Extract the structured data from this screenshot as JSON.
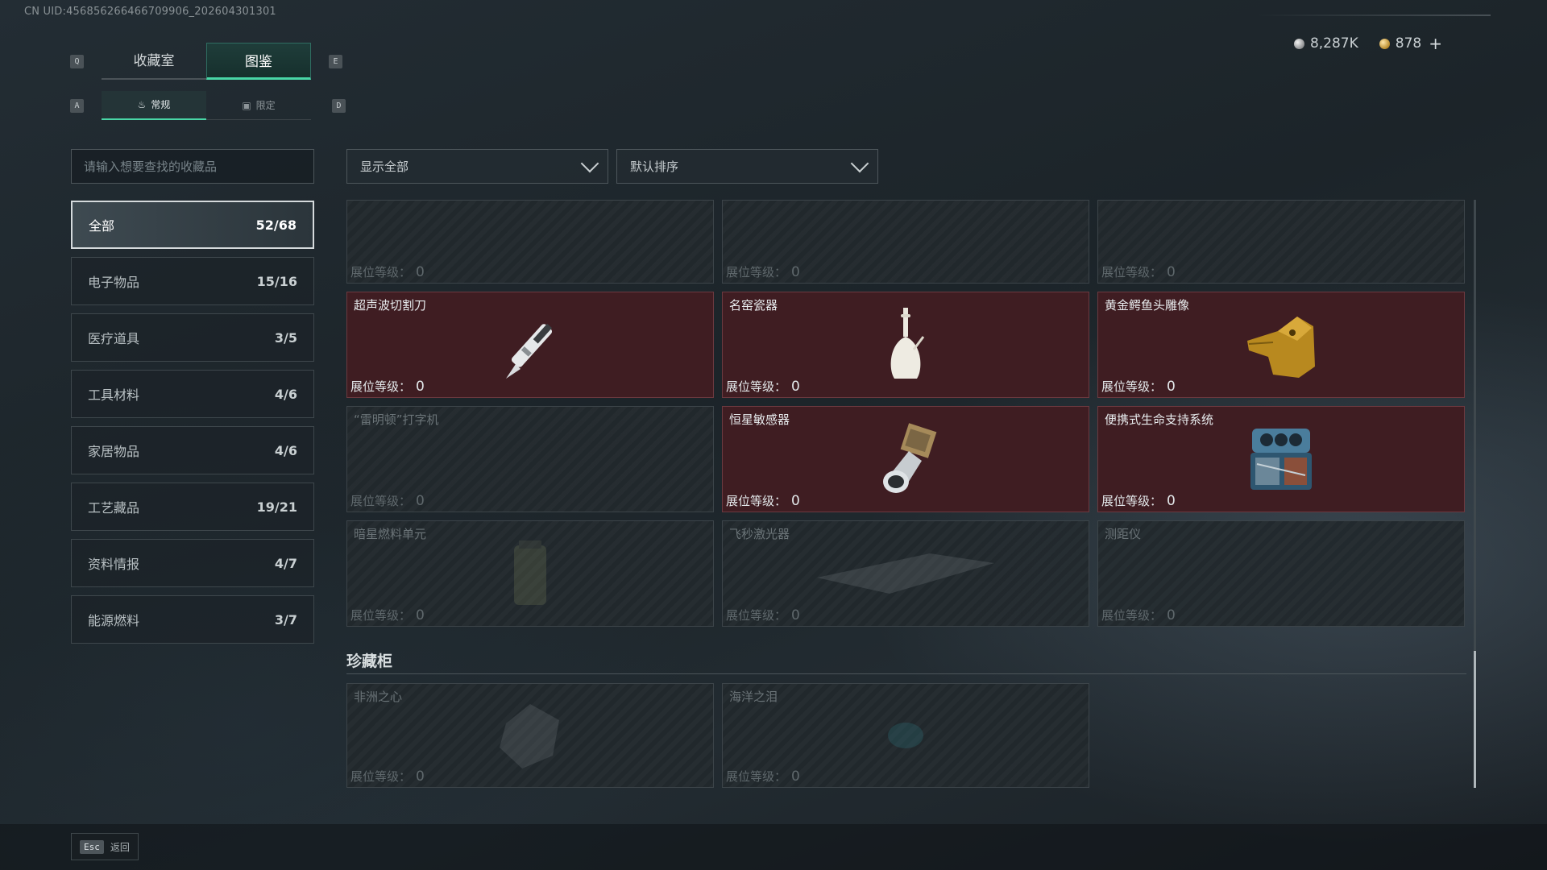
{
  "header": {
    "uid": "CN UID:456856266466709906_202604301301",
    "currency": {
      "silver": "8,287K",
      "gold": "878",
      "add_label": "+"
    }
  },
  "keys": {
    "prev_tab": "Q",
    "next_tab": "E",
    "prev_sub": "A",
    "next_sub": "D"
  },
  "tabs": [
    {
      "label": "收藏室",
      "active": false
    },
    {
      "label": "图鉴",
      "active": true
    }
  ],
  "subtabs": [
    {
      "label": "常规",
      "active": true
    },
    {
      "label": "限定",
      "active": false
    }
  ],
  "search": {
    "placeholder": "请输入想要查找的收藏品"
  },
  "categories": [
    {
      "label": "全部",
      "count": "52/68",
      "active": true
    },
    {
      "label": "电子物品",
      "count": "15/16"
    },
    {
      "label": "医疗道具",
      "count": "3/5"
    },
    {
      "label": "工具材料",
      "count": "4/6"
    },
    {
      "label": "家居物品",
      "count": "4/6"
    },
    {
      "label": "工艺藏品",
      "count": "19/21"
    },
    {
      "label": "资料情报",
      "count": "4/7"
    },
    {
      "label": "能源燃料",
      "count": "3/7"
    }
  ],
  "filters": {
    "show": "显示全部",
    "sort": "默认排序"
  },
  "level_label": "展位等级：",
  "items": [
    {
      "name": "",
      "level": "0",
      "owned": false,
      "icon": "locked-item-icon"
    },
    {
      "name": "",
      "level": "0",
      "owned": false,
      "icon": "locked-item-icon"
    },
    {
      "name": "",
      "level": "0",
      "owned": false,
      "icon": "locked-item-icon"
    },
    {
      "name": "超声波切割刀",
      "level": "0",
      "owned": true,
      "icon": "ultrasonic-knife-icon"
    },
    {
      "name": "名窑瓷器",
      "level": "0",
      "owned": true,
      "icon": "porcelain-vase-icon"
    },
    {
      "name": "黄金鳄鱼头雕像",
      "level": "0",
      "owned": true,
      "icon": "gold-crocodile-icon"
    },
    {
      "name": "“雷明顿”打字机",
      "level": "0",
      "owned": false,
      "icon": "typewriter-icon"
    },
    {
      "name": "恒星敏感器",
      "level": "0",
      "owned": true,
      "icon": "star-sensor-icon"
    },
    {
      "name": "便携式生命支持系统",
      "level": "0",
      "owned": true,
      "icon": "life-support-icon"
    },
    {
      "name": "暗星燃料单元",
      "level": "0",
      "owned": false,
      "icon": "fuel-cell-icon"
    },
    {
      "name": "飞秒激光器",
      "level": "0",
      "owned": false,
      "icon": "laser-icon"
    },
    {
      "name": "测距仪",
      "level": "0",
      "owned": false,
      "icon": "rangefinder-icon"
    }
  ],
  "cabinet": {
    "title": "珍藏柜",
    "items": [
      {
        "name": "非洲之心",
        "level": "0",
        "owned": false,
        "icon": "diamond-icon"
      },
      {
        "name": "海洋之泪",
        "level": "0",
        "owned": false,
        "icon": "gem-icon"
      }
    ]
  },
  "footer": {
    "esc_key": "Esc",
    "back_label": "返回"
  },
  "colors": {
    "accent": "#49d6a6",
    "owned_bg": "#3f1d22",
    "owned_border": "#6c3a40"
  }
}
